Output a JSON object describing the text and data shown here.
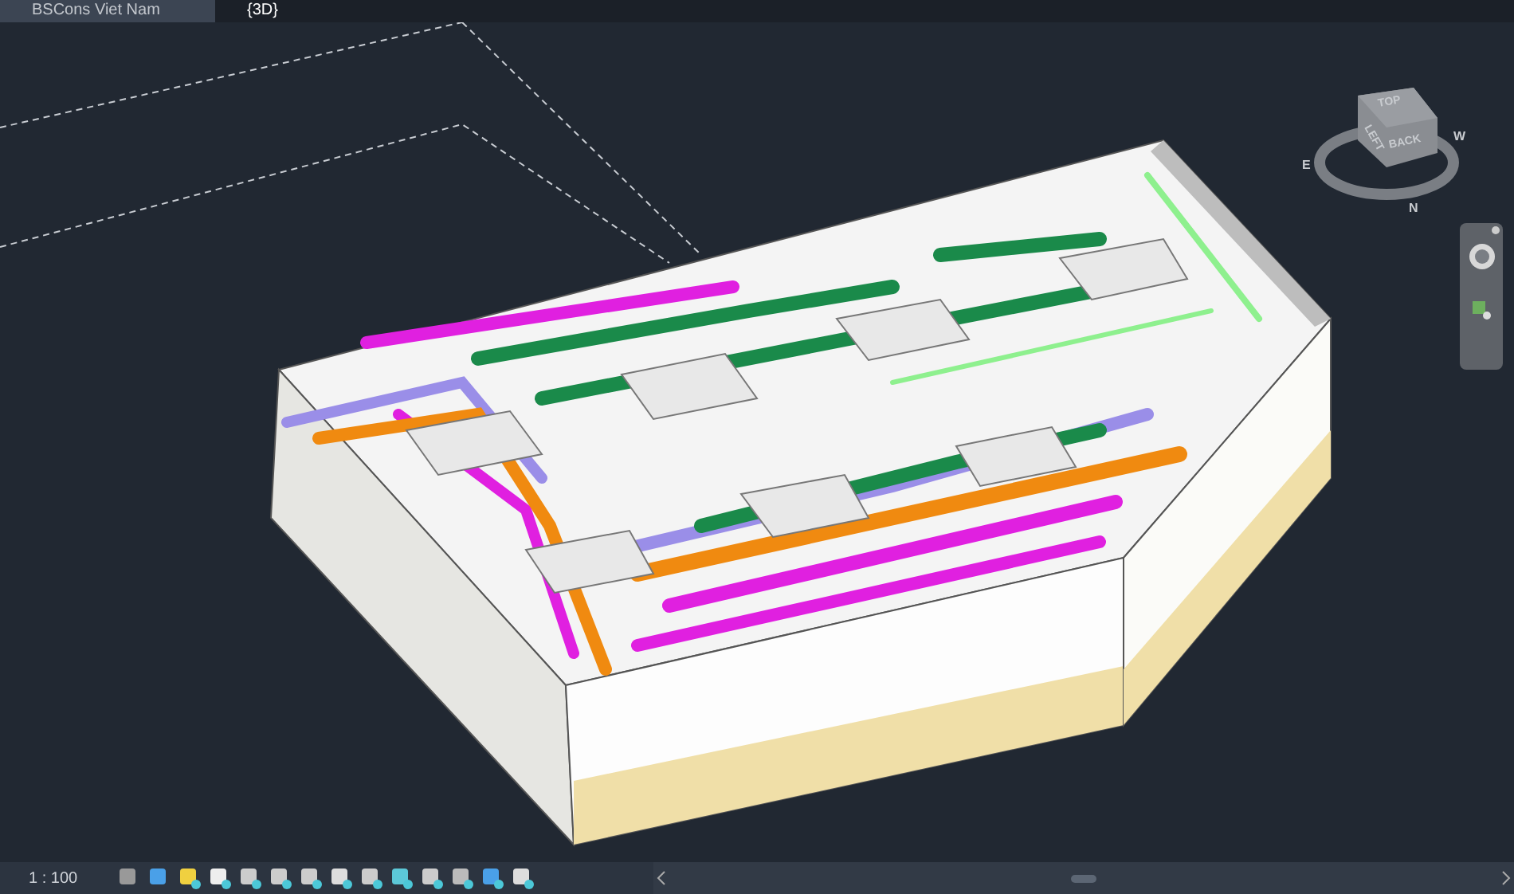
{
  "tabs": [
    {
      "label": "BSCons Viet Nam",
      "selected": false
    },
    {
      "label": "{3D}",
      "selected": true
    }
  ],
  "view_cube": {
    "faces": [
      "TOP",
      "LEFT",
      "BACK"
    ],
    "compass": [
      "E",
      "N",
      "W"
    ]
  },
  "view_control_bar": {
    "scale": "1 : 100"
  }
}
